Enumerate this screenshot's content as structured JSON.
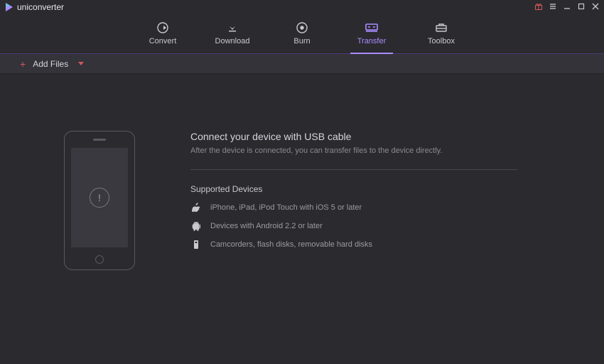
{
  "app": {
    "name": "uniconverter"
  },
  "window_controls": {
    "gift_icon": "gift-icon",
    "menu_icon": "menu-icon",
    "minimize_icon": "minimize-icon",
    "maximize_icon": "maximize-icon",
    "close_icon": "close-icon"
  },
  "tabs": {
    "active": "Transfer",
    "items": [
      {
        "id": "convert",
        "label": "Convert",
        "icon": "cycle-icon"
      },
      {
        "id": "download",
        "label": "Download",
        "icon": "download-icon"
      },
      {
        "id": "burn",
        "label": "Burn",
        "icon": "disc-icon"
      },
      {
        "id": "transfer",
        "label": "Transfer",
        "icon": "transfer-icon"
      },
      {
        "id": "toolbox",
        "label": "Toolbox",
        "icon": "toolbox-icon"
      }
    ]
  },
  "toolbar": {
    "add_files_label": "Add Files"
  },
  "transfer_panel": {
    "title": "Connect your device with USB cable",
    "subtitle": "After the device is connected, you can transfer files to the device directly.",
    "supported_heading": "Supported Devices",
    "devices": [
      {
        "icon": "apple-icon",
        "text": "iPhone, iPad, iPod Touch with iOS 5 or later"
      },
      {
        "icon": "android-icon",
        "text": "Devices with Android 2.2 or later"
      },
      {
        "icon": "storage-icon",
        "text": "Camcorders, flash disks, removable hard disks"
      }
    ]
  }
}
